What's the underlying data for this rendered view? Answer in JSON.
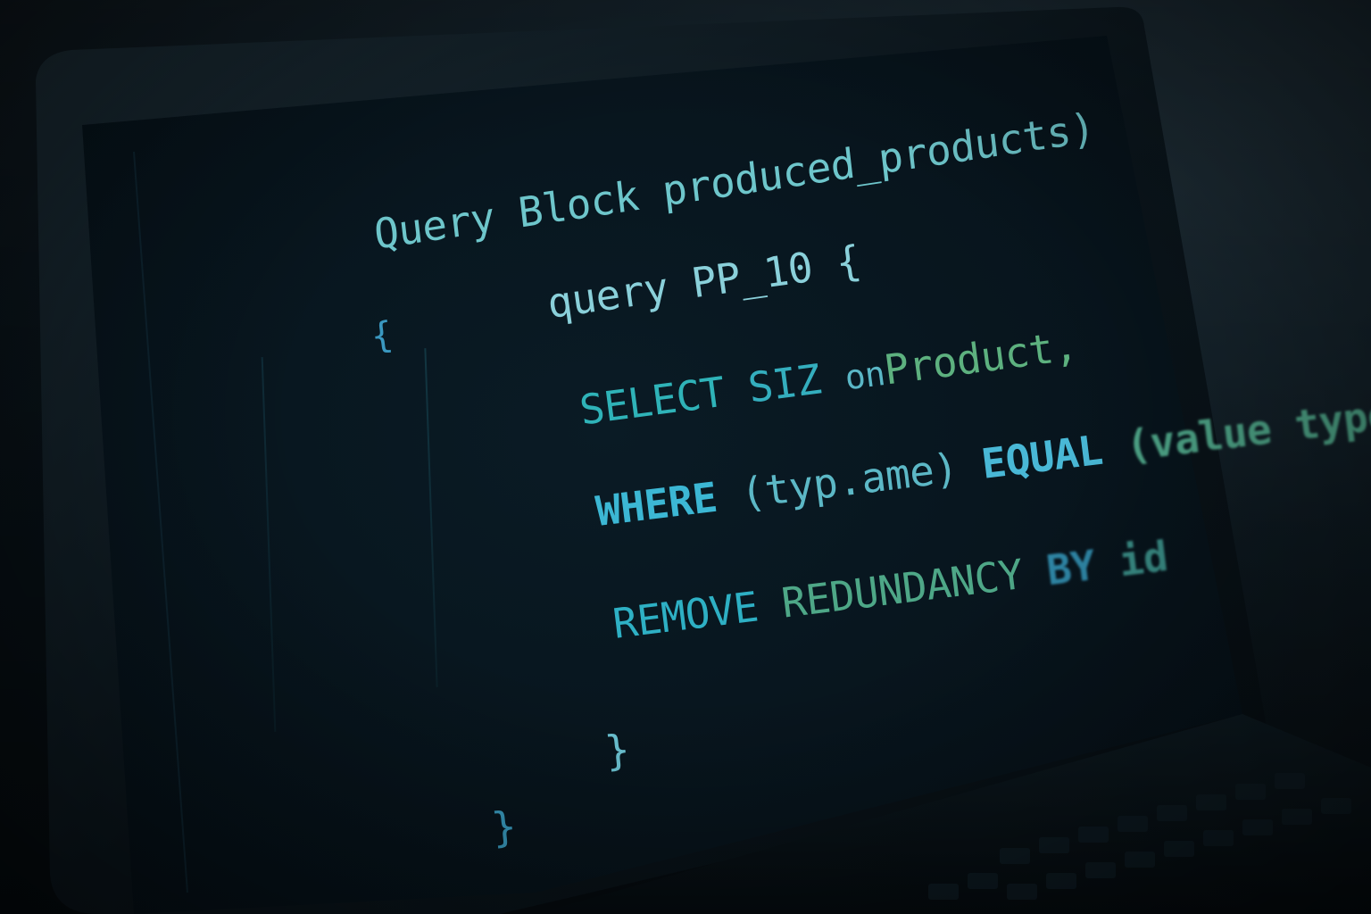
{
  "colors": {
    "keyword": "#34b9c8",
    "identifier": "#8fd3d8",
    "green": "#5fb58a",
    "brace": "#3fa9c4",
    "screen": "#07141d",
    "bezel": "#040a0f"
  },
  "code": {
    "line1": {
      "text": "Query Block produced_products)"
    },
    "line2": {
      "text": "query PP_10 {"
    },
    "line3": {
      "kw": "SELECT",
      "a": "SIZ",
      "b": "on",
      "c": "Product,"
    },
    "line4": {
      "kw": "WHERE",
      "a": "(typ.ame)",
      "b": "EQUAL",
      "c": "(value typo"
    },
    "line5": {
      "kw": "REMOVE",
      "a": "REDUNDANCY",
      "b": "BY",
      "c": "id"
    },
    "open_outer": "{",
    "close_inner": "}",
    "close_outer": "}"
  }
}
